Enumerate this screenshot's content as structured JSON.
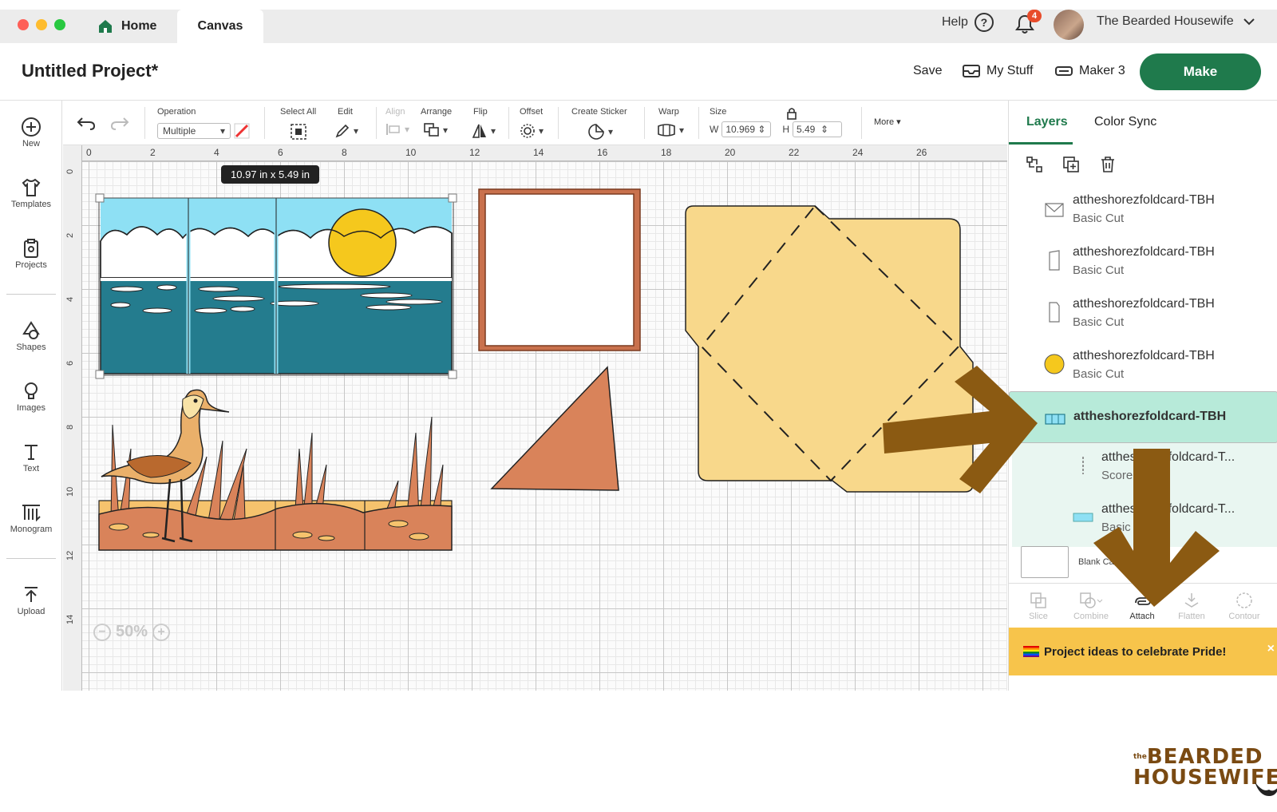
{
  "window": {
    "tabs": [
      {
        "label": "Home"
      },
      {
        "label": "Canvas"
      }
    ],
    "help": "Help",
    "notifications": "4",
    "user": "The Bearded Housewife"
  },
  "project": {
    "title": "Untitled Project*",
    "save": "Save",
    "my_stuff": "My Stuff",
    "machine": "Maker 3",
    "make": "Make"
  },
  "left_tools": [
    "New",
    "Templates",
    "Projects",
    "Shapes",
    "Images",
    "Text",
    "Monogram",
    "Upload"
  ],
  "toolbar": {
    "operation_label": "Operation",
    "operation_value": "Multiple",
    "select_all": "Select All",
    "edit": "Edit",
    "align": "Align",
    "arrange": "Arrange",
    "flip": "Flip",
    "offset": "Offset",
    "create_sticker": "Create Sticker",
    "warp": "Warp",
    "size": "Size",
    "w_label": "W",
    "w_value": "10.969",
    "h_label": "H",
    "h_value": "5.49",
    "more": "More"
  },
  "canvas": {
    "ruler_top": [
      "0",
      "2",
      "4",
      "6",
      "8",
      "10",
      "12",
      "14",
      "16",
      "18",
      "20",
      "22",
      "24",
      "26"
    ],
    "ruler_left": [
      "0",
      "2",
      "4",
      "6",
      "8",
      "10",
      "12",
      "14"
    ],
    "size_tooltip": "10.97  in x 5.49  in",
    "zoom": "50%"
  },
  "panel": {
    "tabs": [
      "Layers",
      "Color Sync"
    ],
    "layers": [
      {
        "name": "attheshorezfoldcard-TBH",
        "sub": "Basic Cut",
        "icon": "envelope-outline-icon"
      },
      {
        "name": "attheshorezfoldcard-TBH",
        "sub": "Basic Cut",
        "icon": "card-outline-icon"
      },
      {
        "name": "attheshorezfoldcard-TBH",
        "sub": "Basic Cut",
        "icon": "card-outline-icon"
      },
      {
        "name": "attheshorezfoldcard-TBH",
        "sub": "Basic Cut",
        "icon": "yellow-circle-icon"
      },
      {
        "name": "attheshorezfoldcard-TBH",
        "sub": "",
        "icon": "group-icon",
        "selected": true
      },
      {
        "name": "attheshorezfoldcard-T...",
        "sub": "Score",
        "icon": "score-line-icon"
      },
      {
        "name": "attheshorezfoldcard-T...",
        "sub": "Basic Cut",
        "icon": "blue-rect-icon"
      }
    ],
    "blank_canvas": "Blank Canvas",
    "bottom_actions": [
      "Slice",
      "Combine",
      "Attach",
      "Flatten",
      "Contour"
    ],
    "banner": "Project ideas to celebrate Pride!"
  },
  "logo": {
    "small": "the",
    "line1": "BEARDED",
    "line2": "HOUSEWIFE"
  },
  "colors": {
    "accent": "#1f7a4c",
    "selected_row": "#b7ead9",
    "banner": "#f7c44b",
    "arrow": "#8b5a12"
  }
}
